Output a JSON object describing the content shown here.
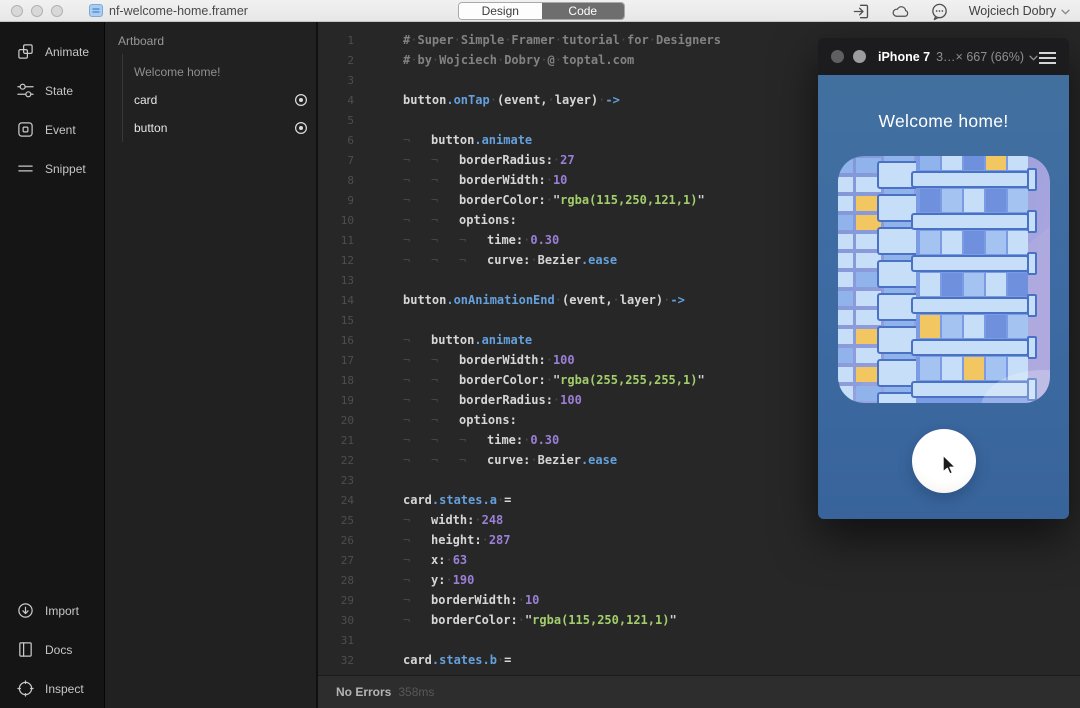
{
  "window": {
    "title": "nf-welcome-home.framer",
    "tabs": [
      {
        "label": "Design",
        "active": false
      },
      {
        "label": "Code",
        "active": true
      }
    ],
    "account": "Wojciech Dobry"
  },
  "toolbar": {
    "top_items": [
      {
        "label": "Animate",
        "icon": "animate-icon"
      },
      {
        "label": "State",
        "icon": "state-icon"
      },
      {
        "label": "Event",
        "icon": "event-icon"
      },
      {
        "label": "Snippet",
        "icon": "snippet-icon"
      }
    ],
    "bottom_items": [
      {
        "label": "Import",
        "icon": "import-icon"
      },
      {
        "label": "Docs",
        "icon": "docs-icon"
      },
      {
        "label": "Inspect",
        "icon": "inspect-icon"
      }
    ]
  },
  "layers": {
    "header": "Artboard",
    "items": [
      {
        "label": "Welcome home!",
        "muted": true,
        "target": false
      },
      {
        "label": "card",
        "muted": false,
        "target": true
      },
      {
        "label": "button",
        "muted": false,
        "target": true
      }
    ]
  },
  "editor": {
    "lines": [
      {
        "n": 1,
        "ind": 0,
        "tok": [
          [
            "com",
            "# Super Simple Framer tutorial for Designers"
          ]
        ]
      },
      {
        "n": 2,
        "ind": 0,
        "tok": [
          [
            "com",
            "# by Wojciech Dobry @ toptal.com"
          ]
        ]
      },
      {
        "n": 3,
        "ind": 0,
        "tok": []
      },
      {
        "n": 4,
        "ind": 0,
        "tok": [
          [
            "pln",
            "button"
          ],
          [
            "kw",
            ".onTap"
          ],
          [
            "pln",
            " (event, layer) "
          ],
          [
            "kw",
            "->"
          ]
        ]
      },
      {
        "n": 5,
        "ind": 0,
        "tok": []
      },
      {
        "n": 6,
        "ind": 1,
        "tok": [
          [
            "pln",
            "button"
          ],
          [
            "kw",
            ".animate"
          ]
        ]
      },
      {
        "n": 7,
        "ind": 2,
        "tok": [
          [
            "pln",
            "borderRadius: "
          ],
          [
            "num",
            "27"
          ]
        ]
      },
      {
        "n": 8,
        "ind": 2,
        "tok": [
          [
            "pln",
            "borderWidth: "
          ],
          [
            "num",
            "10"
          ]
        ]
      },
      {
        "n": 9,
        "ind": 2,
        "tok": [
          [
            "pln",
            "borderColor: "
          ],
          [
            "q",
            "\""
          ],
          [
            "str",
            "rgba(115,250,121,1)"
          ],
          [
            "q",
            "\""
          ]
        ]
      },
      {
        "n": 10,
        "ind": 2,
        "tok": [
          [
            "pln",
            "options:"
          ]
        ]
      },
      {
        "n": 11,
        "ind": 3,
        "tok": [
          [
            "pln",
            "time: "
          ],
          [
            "num",
            "0.30"
          ]
        ]
      },
      {
        "n": 12,
        "ind": 3,
        "tok": [
          [
            "pln",
            "curve: Bezier"
          ],
          [
            "kw",
            ".ease"
          ]
        ]
      },
      {
        "n": 13,
        "ind": 0,
        "tok": []
      },
      {
        "n": 14,
        "ind": 0,
        "tok": [
          [
            "pln",
            "button"
          ],
          [
            "kw",
            ".onAnimationEnd"
          ],
          [
            "pln",
            " (event, layer) "
          ],
          [
            "kw",
            "->"
          ]
        ]
      },
      {
        "n": 15,
        "ind": 0,
        "tok": []
      },
      {
        "n": 16,
        "ind": 1,
        "tok": [
          [
            "pln",
            "button"
          ],
          [
            "kw",
            ".animate"
          ]
        ]
      },
      {
        "n": 17,
        "ind": 2,
        "tok": [
          [
            "pln",
            "borderWidth: "
          ],
          [
            "num",
            "100"
          ]
        ]
      },
      {
        "n": 18,
        "ind": 2,
        "tok": [
          [
            "pln",
            "borderColor: "
          ],
          [
            "q",
            "\""
          ],
          [
            "str",
            "rgba(255,255,255,1)"
          ],
          [
            "q",
            "\""
          ]
        ]
      },
      {
        "n": 19,
        "ind": 2,
        "tok": [
          [
            "pln",
            "borderRadius: "
          ],
          [
            "num",
            "100"
          ]
        ]
      },
      {
        "n": 20,
        "ind": 2,
        "tok": [
          [
            "pln",
            "options:"
          ]
        ]
      },
      {
        "n": 21,
        "ind": 3,
        "tok": [
          [
            "pln",
            "time: "
          ],
          [
            "num",
            "0.30"
          ]
        ]
      },
      {
        "n": 22,
        "ind": 3,
        "tok": [
          [
            "pln",
            "curve: Bezier"
          ],
          [
            "kw",
            ".ease"
          ]
        ]
      },
      {
        "n": 23,
        "ind": 0,
        "tok": []
      },
      {
        "n": 24,
        "ind": 0,
        "tok": [
          [
            "pln",
            "card"
          ],
          [
            "kw",
            ".states.a"
          ],
          [
            "pln",
            " ="
          ]
        ]
      },
      {
        "n": 25,
        "ind": 1,
        "tok": [
          [
            "pln",
            "width: "
          ],
          [
            "num",
            "248"
          ]
        ]
      },
      {
        "n": 26,
        "ind": 1,
        "tok": [
          [
            "pln",
            "height: "
          ],
          [
            "num",
            "287"
          ]
        ]
      },
      {
        "n": 27,
        "ind": 1,
        "tok": [
          [
            "pln",
            "x: "
          ],
          [
            "num",
            "63"
          ]
        ]
      },
      {
        "n": 28,
        "ind": 1,
        "tok": [
          [
            "pln",
            "y: "
          ],
          [
            "num",
            "190"
          ]
        ]
      },
      {
        "n": 29,
        "ind": 1,
        "tok": [
          [
            "pln",
            "borderWidth: "
          ],
          [
            "num",
            "10"
          ]
        ]
      },
      {
        "n": 30,
        "ind": 1,
        "tok": [
          [
            "pln",
            "borderColor: "
          ],
          [
            "q",
            "\""
          ],
          [
            "str",
            "rgba(115,250,121,1)"
          ],
          [
            "q",
            "\""
          ]
        ]
      },
      {
        "n": 31,
        "ind": 0,
        "tok": []
      },
      {
        "n": 32,
        "ind": 0,
        "tok": [
          [
            "pln",
            "card"
          ],
          [
            "kw",
            ".states.b"
          ],
          [
            "pln",
            " ="
          ]
        ]
      }
    ]
  },
  "statusbar": {
    "status": "No Errors",
    "duration": "358ms"
  },
  "preview": {
    "window_title": "iPhone 7",
    "size_label": "3…× 667 (66%)",
    "screen": {
      "title": "Welcome home!"
    }
  },
  "colors": {
    "code_blue": "#64a0dc",
    "code_purple": "#9b7fd6",
    "code_green": "#a3cf6b",
    "screen_blue": "#3e6ba3",
    "card_grad_start": "#8097d9",
    "card_grad_end": "#a9a5de",
    "tile_light": "#c6def7",
    "tile_mid": "#8fb3ea",
    "tile_mid2": "#a5c3f1",
    "tile_dark": "#6f90dd",
    "tile_face": "#7b9ce4",
    "tile_stroke": "#4a72c4",
    "accent_yellow": "#f2c660",
    "button_white": "#ffffff"
  }
}
